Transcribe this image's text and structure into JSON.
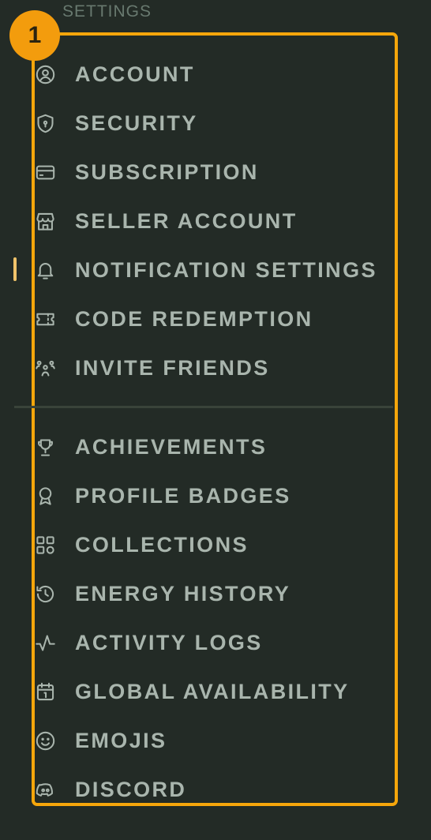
{
  "section_title": "SETTINGS",
  "step_badge": "1",
  "colors": {
    "background": "#232b26",
    "accent": "#f5a60b",
    "text": "#a9b5ad",
    "active_indicator": "#f0c36a"
  },
  "active_item": "notifications",
  "menu_groups": [
    [
      {
        "label": "ACCOUNT",
        "icon": "user-circle-icon"
      },
      {
        "label": "SECURITY",
        "icon": "shield-icon"
      },
      {
        "label": "SUBSCRIPTION",
        "icon": "credit-card-icon"
      },
      {
        "label": "SELLER ACCOUNT",
        "icon": "store-icon"
      },
      {
        "label": "NOTIFICATION SETTINGS",
        "icon": "bell-icon"
      },
      {
        "label": "CODE REDEMPTION",
        "icon": "ticket-icon"
      },
      {
        "label": "INVITE FRIENDS",
        "icon": "users-icon"
      }
    ],
    [
      {
        "label": "ACHIEVEMENTS",
        "icon": "trophy-icon"
      },
      {
        "label": "PROFILE BADGES",
        "icon": "award-icon"
      },
      {
        "label": "COLLECTIONS",
        "icon": "grid-icon"
      },
      {
        "label": "ENERGY HISTORY",
        "icon": "history-icon"
      },
      {
        "label": "ACTIVITY LOGS",
        "icon": "activity-icon"
      },
      {
        "label": "GLOBAL AVAILABILITY",
        "icon": "calendar-icon"
      },
      {
        "label": "EMOJIS",
        "icon": "smiley-icon"
      },
      {
        "label": "DISCORD",
        "icon": "discord-icon"
      }
    ]
  ]
}
